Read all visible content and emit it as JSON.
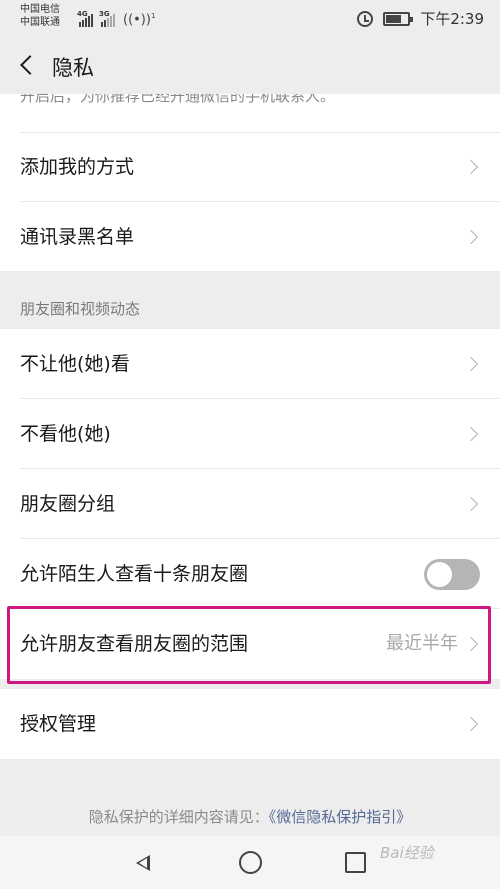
{
  "status_bar": {
    "carrier1": "中国电信",
    "carrier2": "中国联通",
    "net1": "4G",
    "net2": "3G",
    "wifi_badge": "1",
    "time": "下午2:39"
  },
  "header": {
    "title": "隐私"
  },
  "partial_text": "开启后，为你推荐已经开通微信的手机联系人。",
  "group1": {
    "items": [
      {
        "label": "添加我的方式"
      },
      {
        "label": "通讯录黑名单"
      }
    ]
  },
  "moments_section": {
    "header": "朋友圈和视频动态",
    "items": [
      {
        "label": "不让他(她)看"
      },
      {
        "label": "不看他(她)"
      },
      {
        "label": "朋友圈分组"
      }
    ],
    "stranger_toggle": {
      "label": "允许陌生人查看十条朋友圈",
      "on": false
    },
    "range_item": {
      "label": "允许朋友查看朋友圈的范围",
      "value": "最近半年"
    }
  },
  "group3": {
    "items": [
      {
        "label": "授权管理"
      }
    ]
  },
  "footer": {
    "text": "隐私保护的详细内容请见：",
    "link": "《微信隐私保护指引》"
  },
  "watermark": "Bai经验"
}
